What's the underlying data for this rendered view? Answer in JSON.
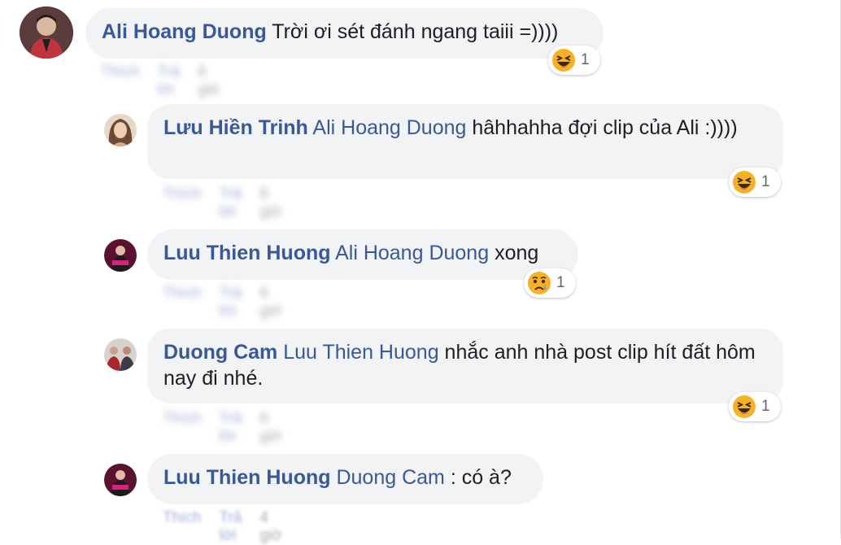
{
  "comments": [
    {
      "author": "Ali Hoang Duong",
      "mention": "",
      "text": "Trời ơi sét đánh ngang taiii =))))",
      "reaction": {
        "icon": "haha-emoji-icon",
        "count": "1"
      },
      "actions": {
        "like": "Thích",
        "reply": "Trả lời",
        "time": "6 giờ"
      }
    },
    {
      "author": "Lưu Hiền Trinh",
      "mention": "Ali Hoang Duong",
      "text": "hâhhahha đợi clip của Ali :))))",
      "reaction": {
        "icon": "haha-emoji-icon",
        "count": "1"
      },
      "actions": {
        "like": "Thích",
        "reply": "Trả lời",
        "time": "6 giờ"
      }
    },
    {
      "author": "Luu Thien Huong",
      "mention": "Ali Hoang Duong",
      "text": "xong",
      "reaction": {
        "icon": "sad-emoji-icon",
        "count": "1"
      },
      "actions": {
        "like": "Thích",
        "reply": "Trả lời",
        "time": "6 giờ"
      }
    },
    {
      "author": "Duong Cam",
      "mention": "Luu Thien Huong",
      "text": "nhắc anh nhà post clip hít đất hôm nay đi nhé.",
      "reaction": {
        "icon": "haha-emoji-icon",
        "count": "1"
      },
      "actions": {
        "like": "Thích",
        "reply": "Trả lời",
        "time": "6 giờ"
      }
    },
    {
      "author": "Luu Thien Huong",
      "mention": "Duong Cam",
      "text": " : có à?",
      "reaction": null,
      "actions": {
        "like": "Thích",
        "reply": "Trả lời",
        "time": "4 giờ"
      }
    }
  ],
  "colors": {
    "author": "#385898",
    "bubble": "#f2f3f5",
    "text": "#1c1e21",
    "haha": "#f7b125",
    "sad": "#f7b125"
  }
}
